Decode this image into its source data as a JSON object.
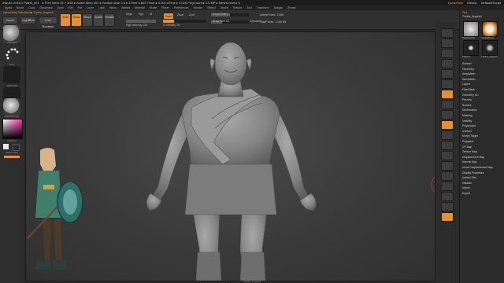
{
  "window": {
    "title": "ZBrush 2018.1   Patrol_v01",
    "stats": "▸ Free Mem 19.7 3GB ▸ Active Mem 457 ▸ Scratch Disk 2.6  ▸ ZTime 9.603 Timer ▸ 0.001 ATime ▸ 0.026 PolyCount ▸ 1.5 MP ▸ MeshCount ▸ 6",
    "right_title": "QuickSave",
    "menus_label": "Menus",
    "default_script": "DefaultZScript"
  },
  "menus": [
    "Alpha",
    "Brush",
    "Color",
    "Document",
    "Draw",
    "Edit",
    "File",
    "Layer",
    "Light",
    "Macro",
    "Marker",
    "Material",
    "Movie",
    "Picker",
    "Preferences",
    "Render",
    "Stencil",
    "Stroke",
    "Texture",
    "Tool",
    "Transform",
    "Zplugin",
    "Zscript"
  ],
  "toolbar": {
    "breadcrumb": "Interactivity Activation ▶ Thulba_Angeled",
    "home_page": "Home Page",
    "lightbox": "LightBox",
    "live_boolean": "Live Boolean",
    "edit": "Edit",
    "draw": "Draw",
    "move": "Move",
    "scale": "Scale",
    "rotate": "Rotate",
    "mrgb": "Mrgb",
    "rgb": "Rgb",
    "m": "M",
    "zadd": "Zadd",
    "zsub": "Zsub",
    "zcut": "Zcut",
    "focal_shift": "Focal Shift 0",
    "draw_size": "Draw Size 64",
    "rgb_intensity": "Rgb Intensity 100",
    "z_intensity": "Z Intensity 25",
    "dynamic": "Dynamic",
    "active_points": "ActivePoints: 3,086",
    "total_points": "TotalPoints: 1.166 Mil"
  },
  "left_shelf": {
    "brush_label": "Standard",
    "stroke_label": "Dots",
    "alpha_label": "Alpha Off",
    "texture_label": "Texture Off",
    "material_label": "MatCap Gray",
    "gradient_label": "Gradient",
    "switch_label": "SwitchColor"
  },
  "right_shelf": [
    "BPR",
    "SPix",
    "Scroll",
    "Zoom",
    "Actual",
    "AAHalf",
    "Persp",
    "Floor",
    "Local",
    "LSym",
    "Frame",
    "Move",
    "Scale",
    "Rotate",
    "PolyF",
    "Transp",
    "Ghost",
    "Solo",
    "Xpose"
  ],
  "tray": {
    "header": "Tool",
    "subtool_label": "Thulba_Angeled",
    "tiles": [
      "PolyMesh3D",
      "SimpleBrush",
      "ZSphere",
      "Thulba_Angeled"
    ],
    "items": [
      "Subtool",
      "Geometry",
      "ArrayMesh",
      "NanoMesh",
      "Layers",
      "FiberMesh",
      "Geometry HD",
      "Preview",
      "Surface",
      "Deformation",
      "Masking",
      "Visibility",
      "Polygroups",
      "Contact",
      "Morph Target",
      "Polypaint",
      "UV Map",
      "Texture Map",
      "Displacement Map",
      "Normal Map",
      "Vector Displacement Map",
      "Display Properties",
      "Unified Skin",
      "Initialize",
      "Import",
      "Export"
    ]
  },
  "viewport": {
    "footer_label": "Thulba_Angeled"
  },
  "colors": {
    "accent": "#e8912c",
    "viewport_bg": "#3a3a3a",
    "panel": "#2b2b2b",
    "red_cursor": "#b04040"
  }
}
